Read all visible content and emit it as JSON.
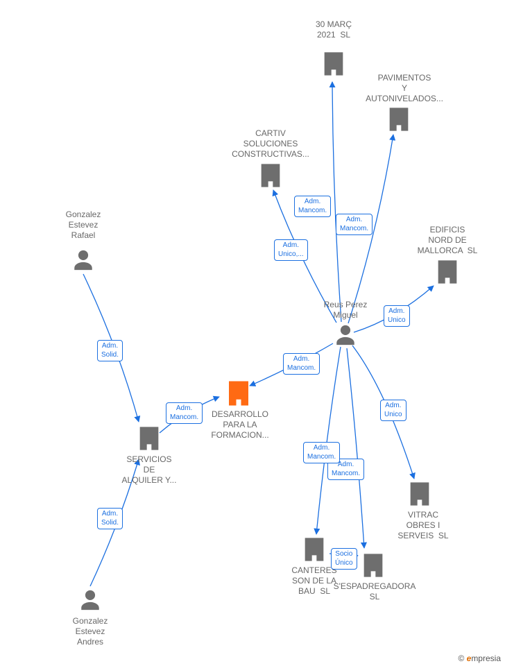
{
  "nodes": {
    "gonzalez_rafael": {
      "label": "Gonzalez\nEstevez\nRafael"
    },
    "gonzalez_andres": {
      "label": "Gonzalez\nEstevez\nAndres"
    },
    "servicios": {
      "label": "SERVICIOS\nDE\nALQUILER Y..."
    },
    "reus": {
      "label": "Reus Perez\nMiguel"
    },
    "marc30": {
      "label": "30 MARÇ\n2021  SL"
    },
    "pavimentos": {
      "label": "PAVIMENTOS\nY\nAUTONIVELADOS..."
    },
    "cartiv": {
      "label": "CARTIV\nSOLUCIONES\nCONSTRUCTIVAS..."
    },
    "edificis": {
      "label": "EDIFICIS\nNORD DE\nMALLORCA  SL"
    },
    "vitrac": {
      "label": "VITRAC\nOBRES I\nSERVEIS  SL"
    },
    "espadregadora": {
      "label": "S'ESPADREGADORA\nSL"
    },
    "canteres": {
      "label": "CANTERES\nSON DE LA\nBAU  SL"
    },
    "desarrollo": {
      "label": "DESARROLLO\nPARA LA\nFORMACION..."
    }
  },
  "edges": {
    "rafael_servicios": {
      "label": "Adm.\nSolid."
    },
    "andres_servicios": {
      "label": "Adm.\nSolid."
    },
    "reus_marc30": {
      "label": "Adm.\nMancom."
    },
    "reus_pavimentos": {
      "label": "Adm.\nMancom."
    },
    "reus_cartiv": {
      "label": "Adm.\nUnico,..."
    },
    "reus_edificis": {
      "label": "Adm.\nUnico"
    },
    "reus_vitrac": {
      "label": "Adm.\nUnico"
    },
    "reus_espadregadora": {
      "label": "Adm.\nMancom."
    },
    "reus_canteres": {
      "label": "Adm.\nMancom."
    },
    "reus_desarrollo": {
      "label": "Adm.\nMancom."
    },
    "servicios_desarrollo": {
      "label": "Adm.\nMancom."
    },
    "canteres_espadregadora": {
      "label": "Socio\nÚnico"
    }
  },
  "copyright": "© ",
  "brand_e": "e",
  "brand_rest": "mpresia"
}
